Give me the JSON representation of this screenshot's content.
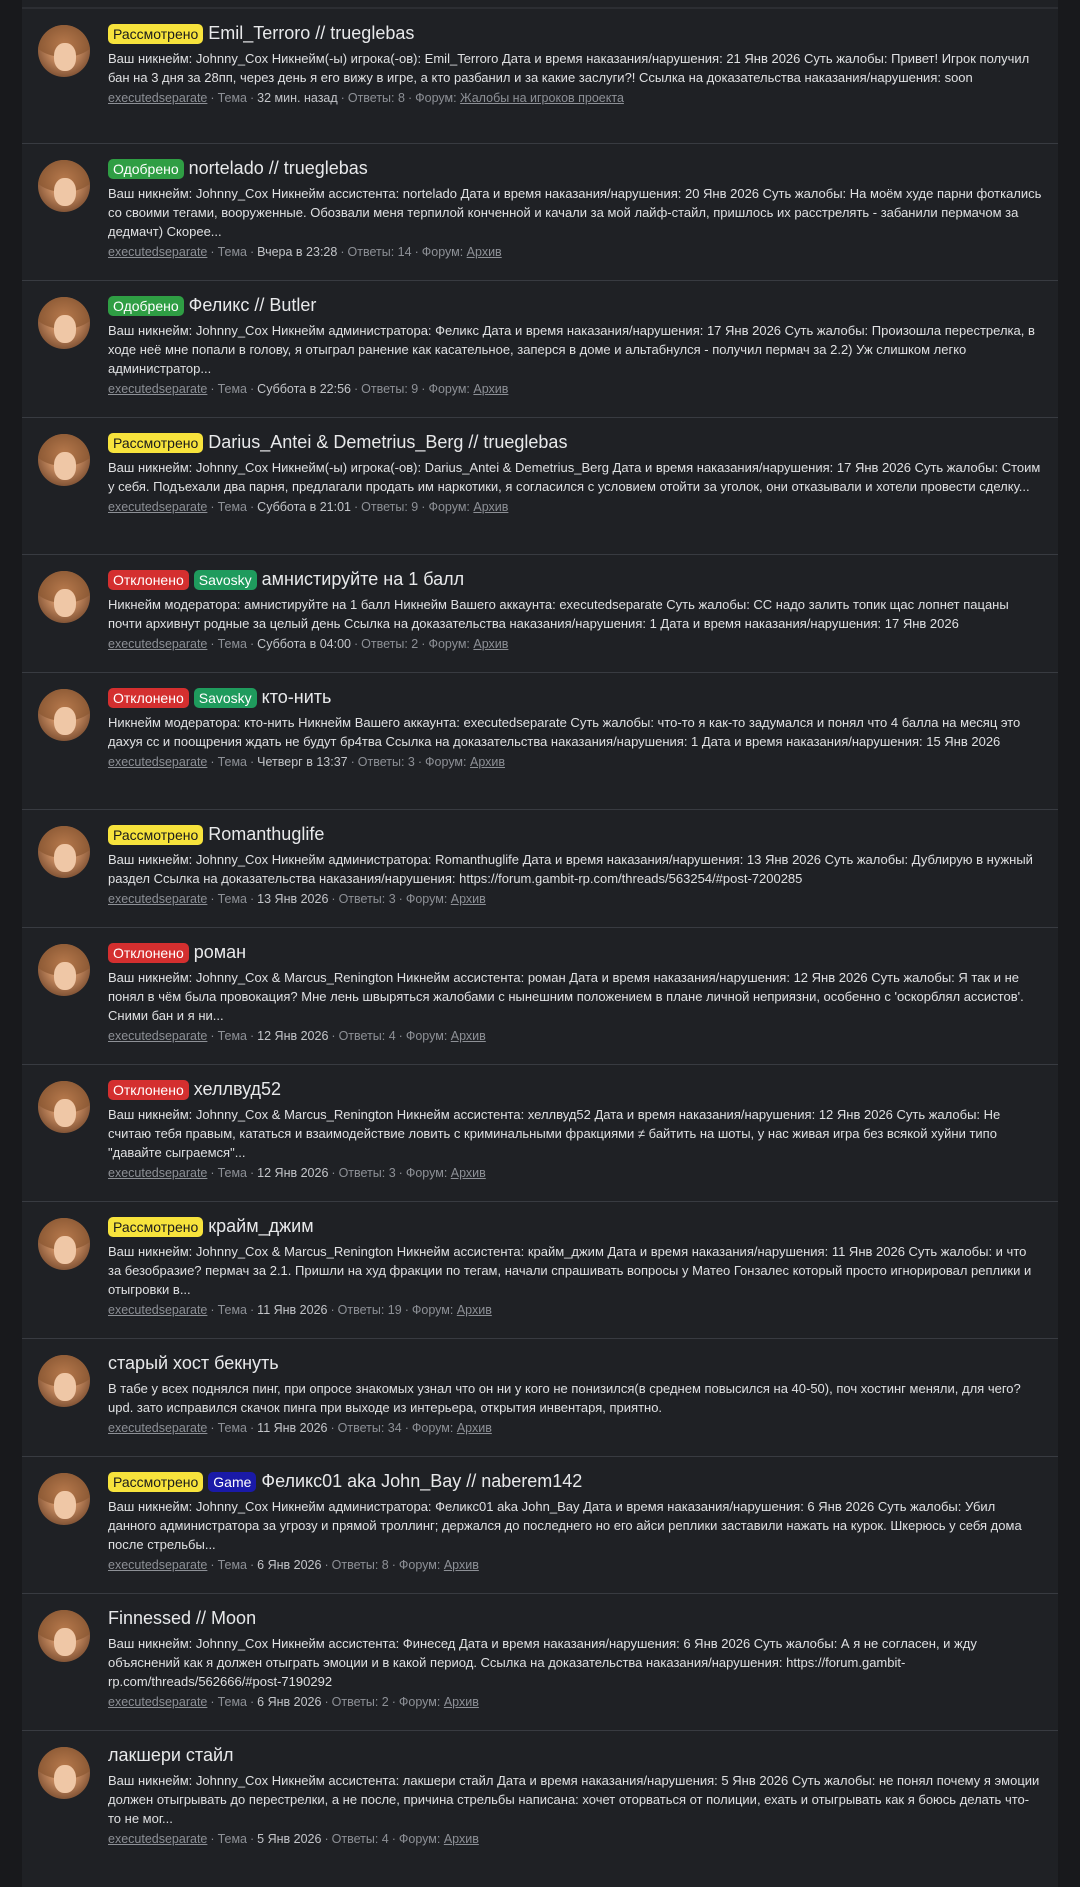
{
  "threads": [
    {
      "labels": [
        {
          "text": "Рассмотрено",
          "kind": "reviewed"
        }
      ],
      "title": "Emil_Terroro // trueglebas",
      "snippet": "Ваш никнейм: Johnny_Cox Никнейм(-ы) игрока(-ов): Emil_Terroro Дата и время наказания/нарушения: 21 Янв 2026 Суть жалобы: Привет! Игрок получил бан на 3 дня за 28пп, через день я его вижу в игре, а кто разбанил и за какие заслуги?! Ссылка на доказательства наказания/нарушения: soon",
      "author": "executedseparate",
      "type": "Тема",
      "date": "32 мин. назад",
      "replies": "Ответы: 8",
      "forum_prefix": "Форум:",
      "forum": "Жалобы на игроков проекта"
    },
    {
      "labels": [
        {
          "text": "Одобрено",
          "kind": "approved"
        }
      ],
      "title": "nortelado // trueglebas",
      "snippet": "Ваш никнейм: Johnny_Cox Никнейм ассистента: nortelado Дата и время наказания/нарушения: 20 Янв 2026 Суть жалобы: На моём худе парни фоткались со своими тегами, вооруженные. Обозвали меня терпилой конченной и качали за мой лайф-стайл, пришлось их расстрелять - забанили пермачом за дедмачт) Скорее...",
      "author": "executedseparate",
      "type": "Тема",
      "date": "Вчера в 23:28",
      "replies": "Ответы: 14",
      "forum_prefix": "Форум:",
      "forum": "Архив"
    },
    {
      "labels": [
        {
          "text": "Одобрено",
          "kind": "approved"
        }
      ],
      "title": "Феликс // Butler",
      "snippet": "Ваш никнейм: Johnny_Cox Никнейм администратора: Феликс Дата и время наказания/нарушения: 17 Янв 2026 Суть жалобы: Произошла перестрелка, в ходе неё мне попали в голову, я отыграл ранение как касательное, заперся в доме и альтабнулся - получил пермач за 2.2) Уж слишком легко администратор...",
      "author": "executedseparate",
      "type": "Тема",
      "date": "Суббота в 22:56",
      "replies": "Ответы: 9",
      "forum_prefix": "Форум:",
      "forum": "Архив"
    },
    {
      "labels": [
        {
          "text": "Рассмотрено",
          "kind": "reviewed"
        }
      ],
      "title": "Darius_Antei & Demetrius_Berg // trueglebas",
      "snippet": "Ваш никнейм: Johnny_Cox Никнейм(-ы) игрока(-ов): Darius_Antei & Demetrius_Berg Дата и время наказания/нарушения: 17 Янв 2026 Суть жалобы: Стоим у себя. Подъехали два парня, предлагали продать им наркотики, я согласился с условием отойти за уголок, они отказывали и хотели провести сделку...",
      "author": "executedseparate",
      "type": "Тема",
      "date": "Суббота в 21:01",
      "replies": "Ответы: 9",
      "forum_prefix": "Форум:",
      "forum": "Архив"
    },
    {
      "labels": [
        {
          "text": "Отклонено",
          "kind": "declined"
        },
        {
          "text": "Savosky",
          "kind": "savosky"
        }
      ],
      "title": "амнистируйте на 1 балл",
      "snippet": "Никнейм модератора: амнистируйте на 1 балл Никнейм Вашего аккаунта: executedseparate Суть жалобы: СС надо залить топик щас лопнет пацаны почти архивнут родные за целый день Ссылка на доказательства наказания/нарушения: 1 Дата и время наказания/нарушения: 17 Янв 2026",
      "author": "executedseparate",
      "type": "Тема",
      "date": "Суббота в 04:00",
      "replies": "Ответы: 2",
      "forum_prefix": "Форум:",
      "forum": "Архив"
    },
    {
      "labels": [
        {
          "text": "Отклонено",
          "kind": "declined"
        },
        {
          "text": "Savosky",
          "kind": "savosky"
        }
      ],
      "title": "кто-нить",
      "snippet": "Никнейм модератора: кто-нить Никнейм Вашего аккаунта: executedseparate Суть жалобы: что-то я как-то задумался и понял что 4 балла на месяц это дахуя сс и поощрения ждать не будут бр4тва Ссылка на доказательства наказания/нарушения: 1 Дата и время наказания/нарушения: 15 Янв 2026",
      "author": "executedseparate",
      "type": "Тема",
      "date": "Четверг в 13:37",
      "replies": "Ответы: 3",
      "forum_prefix": "Форум:",
      "forum": "Архив"
    },
    {
      "labels": [
        {
          "text": "Рассмотрено",
          "kind": "reviewed"
        }
      ],
      "title": "Romanthuglife",
      "snippet": "Ваш никнейм: Johnny_Cox Никнейм администратора: Romanthuglife Дата и время наказания/нарушения: 13 Янв 2026 Суть жалобы: Дублирую в нужный раздел Ссылка на доказательства наказания/нарушения: https://forum.gambit-rp.com/threads/563254/#post-7200285",
      "author": "executedseparate",
      "type": "Тема",
      "date": "13 Янв 2026",
      "replies": "Ответы: 3",
      "forum_prefix": "Форум:",
      "forum": "Архив"
    },
    {
      "labels": [
        {
          "text": "Отклонено",
          "kind": "declined"
        }
      ],
      "title": "роман",
      "snippet": "Ваш никнейм: Johnny_Cox & Marcus_Renington Никнейм ассистента: роман Дата и время наказания/нарушения: 12 Янв 2026 Суть жалобы: Я так и не понял в чём была провокация? Мне лень швыряться жалобами с нынешним положением в плане личной неприязни, особенно с 'оскорблял ассистов'. Сними бан и я ни...",
      "author": "executedseparate",
      "type": "Тема",
      "date": "12 Янв 2026",
      "replies": "Ответы: 4",
      "forum_prefix": "Форум:",
      "forum": "Архив"
    },
    {
      "labels": [
        {
          "text": "Отклонено",
          "kind": "declined"
        }
      ],
      "title": "хеллвуд52",
      "snippet": "Ваш никнейм: Johnny_Cox & Marcus_Renington Никнейм ассистента: хеллвуд52 Дата и время наказания/нарушения: 12 Янв 2026 Суть жалобы: Не считаю тебя правым, кататься и взаимодействие ловить с криминальными фракциями ≠ байтить на шоты, у нас живая игра без всякой хуйни типо \"давайте сыграемся\"...",
      "author": "executedseparate",
      "type": "Тема",
      "date": "12 Янв 2026",
      "replies": "Ответы: 3",
      "forum_prefix": "Форум:",
      "forum": "Архив"
    },
    {
      "labels": [
        {
          "text": "Рассмотрено",
          "kind": "reviewed"
        }
      ],
      "title": "крайм_джим",
      "snippet": "Ваш никнейм: Johnny_Cox & Marcus_Renington Никнейм ассистента: крайм_джим Дата и время наказания/нарушения: 11 Янв 2026 Суть жалобы: и что за безобразие? пермач за 2.1. Пришли на худ фракции по тегам, начали спрашивать вопросы у Матео Гонзалес который просто игнорировал реплики и отыгровки в...",
      "author": "executedseparate",
      "type": "Тема",
      "date": "11 Янв 2026",
      "replies": "Ответы: 19",
      "forum_prefix": "Форум:",
      "forum": "Архив"
    },
    {
      "labels": [],
      "title": "старый хост бекнуть",
      "snippet": "В табе у всех поднялся пинг, при опросе знакомых узнал что он ни у кого не понизился(в среднем повысился на 40-50), поч хостинг меняли, для чего? upd. зато исправился скачок пинга при выходе из интерьера, открытия инвентаря, приятно.",
      "author": "executedseparate",
      "type": "Тема",
      "date": "11 Янв 2026",
      "replies": "Ответы: 34",
      "forum_prefix": "Форум:",
      "forum": "Архив"
    },
    {
      "labels": [
        {
          "text": "Рассмотрено",
          "kind": "reviewed"
        },
        {
          "text": "Game",
          "kind": "game"
        }
      ],
      "title": "Феликс01 aka John_Bay // naberem142",
      "snippet": "Ваш никнейм: Johnny_Cox Никнейм администратора: Феликс01 aka John_Bay Дата и время наказания/нарушения: 6 Янв 2026 Суть жалобы: Убил данного администратора за угрозу и прямой троллинг; держался до последнего но его айси реплики заставили нажать на курок. Шкерюсь у себя дома после стрельбы...",
      "author": "executedseparate",
      "type": "Тема",
      "date": "6 Янв 2026",
      "replies": "Ответы: 8",
      "forum_prefix": "Форум:",
      "forum": "Архив"
    },
    {
      "labels": [],
      "title": "Finnessed // Moon",
      "snippet": "Ваш никнейм: Johnny_Cox Никнейм ассистента: Финесед Дата и время наказания/нарушения: 6 Янв 2026 Суть жалобы: А я не согласен, и жду объяснений как я должен отыграть эмоции и в какой период. Ссылка на доказательства наказания/нарушения: https://forum.gambit-rp.com/threads/562666/#post-7190292",
      "author": "executedseparate",
      "type": "Тема",
      "date": "6 Янв 2026",
      "replies": "Ответы: 2",
      "forum_prefix": "Форум:",
      "forum": "Архив"
    },
    {
      "labels": [],
      "title": "лакшери стайл",
      "snippet": "Ваш никнейм: Johnny_Cox Никнейм ассистента: лакшери стайл Дата и время наказания/нарушения: 5 Янв 2026 Суть жалобы: не понял почему я эмоции должен отыгрывать до перестрелки, а не после, причина стрельбы написана: хочет оторваться от полиции, ехать и отыгрывать как я боюсь делать что-то не мог...",
      "author": "executedseparate",
      "type": "Тема",
      "date": "5 Янв 2026",
      "replies": "Ответы: 4",
      "forum_prefix": "Форум:",
      "forum": "Архив"
    }
  ]
}
